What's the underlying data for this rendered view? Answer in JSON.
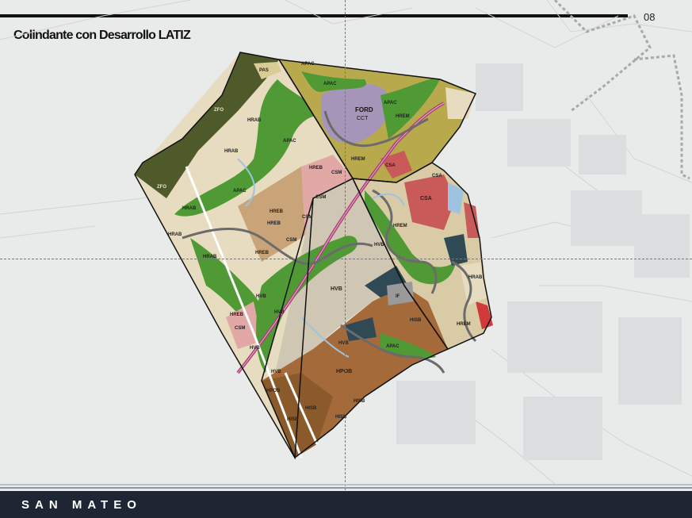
{
  "page": {
    "number": "08",
    "title": "Colindante con Desarrollo LATIZ",
    "brand": "SAN MATEO"
  },
  "map": {
    "labels": {
      "pas": "PAS",
      "zfo_top": "ZFO",
      "zfo_left": "ZFO",
      "hrab_1": "HRAB",
      "hrab_2": "HRAB",
      "hrab_3": "HRAB",
      "hrab_4": "HRAB",
      "hrab_5": "HRAB",
      "apac_1": "APAC",
      "apac_2": "APAC",
      "apac_3": "APAC",
      "apac_4": "APAC",
      "apac_5": "APAC",
      "apac_6": "APAC",
      "hreb_1": "HREB",
      "hreb_2": "HREB",
      "hreb_3": "HREB",
      "hreb_4": "HREB",
      "hreb_5": "HREB",
      "csm_1": "CSM",
      "csm_2": "CSM",
      "csm_3": "CSM",
      "csm_4": "CSM",
      "csm_5": "CSM",
      "ford": "FORD",
      "cct": "CCT",
      "hrem_1": "HREM",
      "hrem_2": "HREM",
      "hrem_3": "HREM",
      "csa_1": "CSA",
      "csa_2": "CSA",
      "csa_3": "CSA",
      "hvb_1": "HVB",
      "hvb_2": "HVB",
      "hvb_3": "HVB",
      "hvb_4": "HVB",
      "hvb_5": "HVB",
      "hvb_6": "HVB",
      "hvb_7": "HVB",
      "hisb_1": "HISB",
      "hisb_2": "HISB",
      "hisb_3": "HISB",
      "hisb_4": "HISB",
      "hisb_5": "HISB",
      "hpob_1": "HPOB",
      "hpob_2": "HPOB",
      "if": "IF",
      "hrab_east": "HRAB",
      "hrem_east": "HREM"
    }
  },
  "colors": {
    "background": "#e9eaea",
    "zfo": "#4e5a2a",
    "hrab": "#e8dcc0",
    "apac": "#4f9a35",
    "csm": "#e2a8a6",
    "hreb": "#c8a478",
    "ford": "#a595b8",
    "hrem": "#b8a94c",
    "csa": "#c95a5a",
    "hvb": "#cfc7b4",
    "hisb": "#a56a3a",
    "hpob": "#8b5a2b",
    "water": "#9ec3e0",
    "road": "#6b6b6b",
    "highway": "#b0407a",
    "footer": "#1f2633"
  }
}
